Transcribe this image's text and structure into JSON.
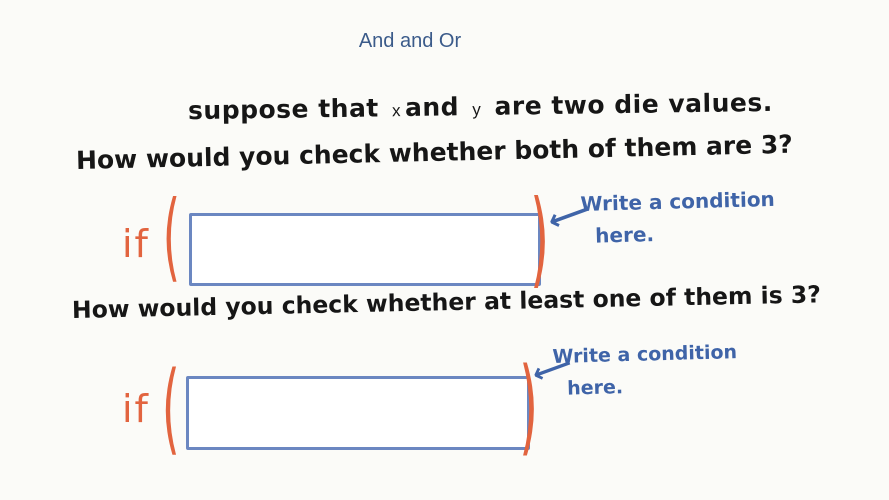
{
  "header": {
    "title": "And and Or"
  },
  "problem": {
    "intro_before_x": "suppose that",
    "var_x": "x",
    "intro_and": "and",
    "var_y": "y",
    "intro_after_y": "are  two die values.",
    "question_both": "How would you check whether both of them are 3?",
    "question_at_least_one": "How would you check whether at least one of them is 3?"
  },
  "code": {
    "keyword": "if",
    "open_paren": "(",
    "close_paren": ")"
  },
  "hints": {
    "line1": "Write a condition",
    "line2": "here."
  },
  "colors": {
    "title": "#3b5b8a",
    "if_keyword": "#e2643f",
    "box_border": "#6b87c1",
    "hint": "#3f64a8"
  }
}
